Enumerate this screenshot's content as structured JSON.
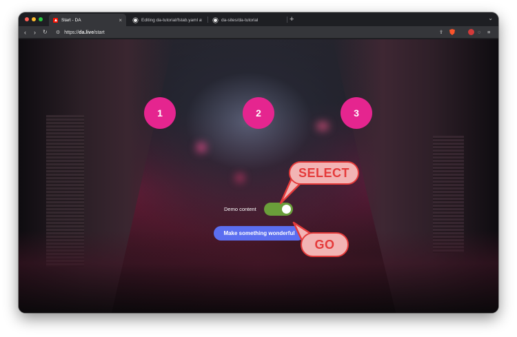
{
  "browser": {
    "tabs": [
      {
        "title": "Start - DA",
        "active": true,
        "icon": "adobe-icon",
        "close": "×"
      },
      {
        "title": "Editing da-tutorial/fstab.yaml at …",
        "active": false,
        "icon": "github-icon"
      },
      {
        "title": "da-sites/da-tutorial",
        "active": false,
        "icon": "github-icon"
      }
    ],
    "new_tab": "+",
    "tab_list": "⌄",
    "nav": {
      "back": "‹",
      "forward": "›",
      "reload": "↻"
    },
    "url_prefix": "https://",
    "url_host": "da.live",
    "url_path": "/start"
  },
  "page": {
    "steps": [
      "1",
      "2",
      "3"
    ],
    "step_color": "#e5258f",
    "toggle": {
      "label": "Demo content",
      "state": "on",
      "color": "#6a9e3a"
    },
    "cta": {
      "label": "Make something wonderful",
      "color": "#5b6ef0"
    }
  },
  "annotations": {
    "select": "SELECT",
    "go": "GO",
    "fill": "#f2b4b4",
    "stroke": "#e53a3a"
  }
}
